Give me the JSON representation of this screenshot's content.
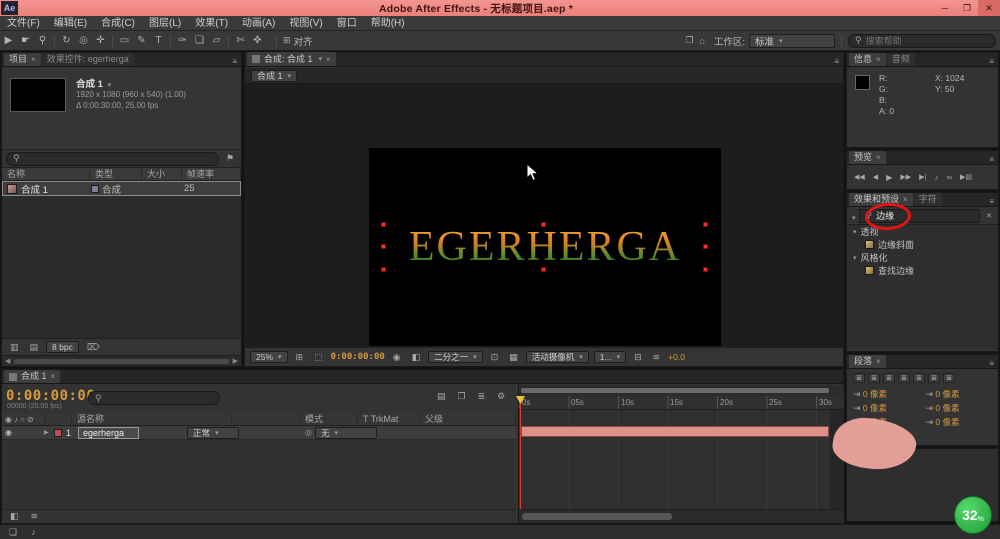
{
  "icons": {
    "app_badge": "Ae",
    "win_min": "─",
    "win_max": "❐",
    "win_close": "✕",
    "panel_menu": "≡",
    "tab_close": "×",
    "dropdown": "▾",
    "trash": "⌦",
    "flag": "⚑",
    "scroll_left": "◀",
    "scroll_right": "▶",
    "eye": "◉",
    "audio_col": "♪",
    "solo": "○",
    "lock": "⊘",
    "parent_pick": "◎",
    "expander": "▶",
    "comp_mini": "▤",
    "frame_blend": "❐",
    "graph": "≣",
    "gear": "⚙",
    "grid_opts": "⊞",
    "mask_toggle": "⬚",
    "snapshot": "◉",
    "channels": "◧",
    "roi": "⊡",
    "checker": "▦",
    "pixel_ratio": "⊟",
    "fast_preview": "≋",
    "snap": "⊞",
    "home": "⌂",
    "layout": "❐"
  },
  "titlebar": {
    "title": "Adobe After Effects - 无标题项目.aep *"
  },
  "menubar": {
    "items": [
      "文件(F)",
      "编辑(E)",
      "合成(C)",
      "图层(L)",
      "效果(T)",
      "动画(A)",
      "视图(V)",
      "窗口",
      "帮助(H)"
    ]
  },
  "toolbar": {
    "tools": [
      {
        "name": "selection",
        "glyph": "▶"
      },
      {
        "name": "hand",
        "glyph": "☛"
      },
      {
        "name": "zoom",
        "glyph": "⚲"
      },
      {
        "name": "rotation",
        "glyph": "↻"
      },
      {
        "name": "unified-camera",
        "glyph": "◎"
      },
      {
        "name": "pan-behind",
        "glyph": "✛"
      },
      {
        "name": "shape",
        "glyph": "▭"
      },
      {
        "name": "pen",
        "glyph": "✎"
      },
      {
        "name": "type",
        "glyph": "T"
      },
      {
        "name": "brush",
        "glyph": "✑"
      },
      {
        "name": "clone-stamp",
        "glyph": "❏"
      },
      {
        "name": "eraser",
        "glyph": "▱"
      },
      {
        "name": "roto-brush",
        "glyph": "✄"
      },
      {
        "name": "puppet",
        "glyph": "✜"
      }
    ],
    "align_label": "对齐",
    "workspace_label": "工作区:",
    "workspace_value": "标准",
    "search_placeholder": "搜索帮助"
  },
  "project": {
    "tab_project": "项目",
    "tab_effect_controls": "效果控件: egerherga",
    "comp_name": "合成 1",
    "info_line1": "1920 x 1080  (960 x 540) (1.00)",
    "info_line2": "Δ 0:00:30:00, 25.00 fps",
    "columns": [
      "名称",
      "类型",
      "大小",
      "帧速率"
    ],
    "row": {
      "name": "合成 1",
      "type": "合成",
      "rate": "25"
    },
    "depth": "8 bpc"
  },
  "viewer": {
    "tab": "合成: 合成 1",
    "chip": "合成 1",
    "canvas_text": "EGERHERGA",
    "zoom": "25%",
    "timecode": "0:00:00:00",
    "resolution": "二分之一",
    "camera": "活动摄像机",
    "views": "1...",
    "exposure": "+0.0"
  },
  "info": {
    "tab_info": "信息",
    "tab_audio": "音频",
    "r": "R:",
    "g": "G:",
    "b": "B:",
    "a": "A: 0",
    "x": "X: 1024",
    "y": "Y: 50"
  },
  "preview": {
    "tab": "预览",
    "buttons": [
      {
        "name": "first-frame",
        "glyph": "◀◀"
      },
      {
        "name": "prev-frame",
        "glyph": "◀"
      },
      {
        "name": "play",
        "glyph": "▶"
      },
      {
        "name": "next-frame",
        "glyph": "▶▶"
      },
      {
        "name": "last-frame",
        "glyph": "▶|"
      },
      {
        "name": "audio",
        "glyph": "♪"
      },
      {
        "name": "loop",
        "glyph": "∞"
      },
      {
        "name": "ram-preview",
        "glyph": "▶▤"
      }
    ]
  },
  "effects": {
    "tab_effects": "效果和预设",
    "tab_character": "字符",
    "search_value": "边缘",
    "cat1": "透视",
    "item1": "边缘斜面",
    "cat2": "风格化",
    "item2": "查找边缘"
  },
  "paragraph": {
    "tab": "段落",
    "fields": [
      "0 像素",
      "0 像素",
      "0 像素",
      "0 像素",
      "0 像素",
      "0 像素"
    ]
  },
  "timeline": {
    "tab": "合成 1",
    "timecode": "0:00:00:00",
    "timecode_sub": "00000 (25.00 fps)",
    "col_source": "源名称",
    "col_mode": "模式",
    "col_trkmat": "T TrkMat",
    "col_parent": "父级",
    "layer_index": "1",
    "layer_name": "egerherga",
    "layer_mode": "正常",
    "layer_parent": "无",
    "ruler": [
      "0s",
      "05s",
      "10s",
      "15s",
      "20s",
      "25s",
      "30s"
    ]
  },
  "watermark": {
    "value": "32",
    "unit": "%"
  }
}
